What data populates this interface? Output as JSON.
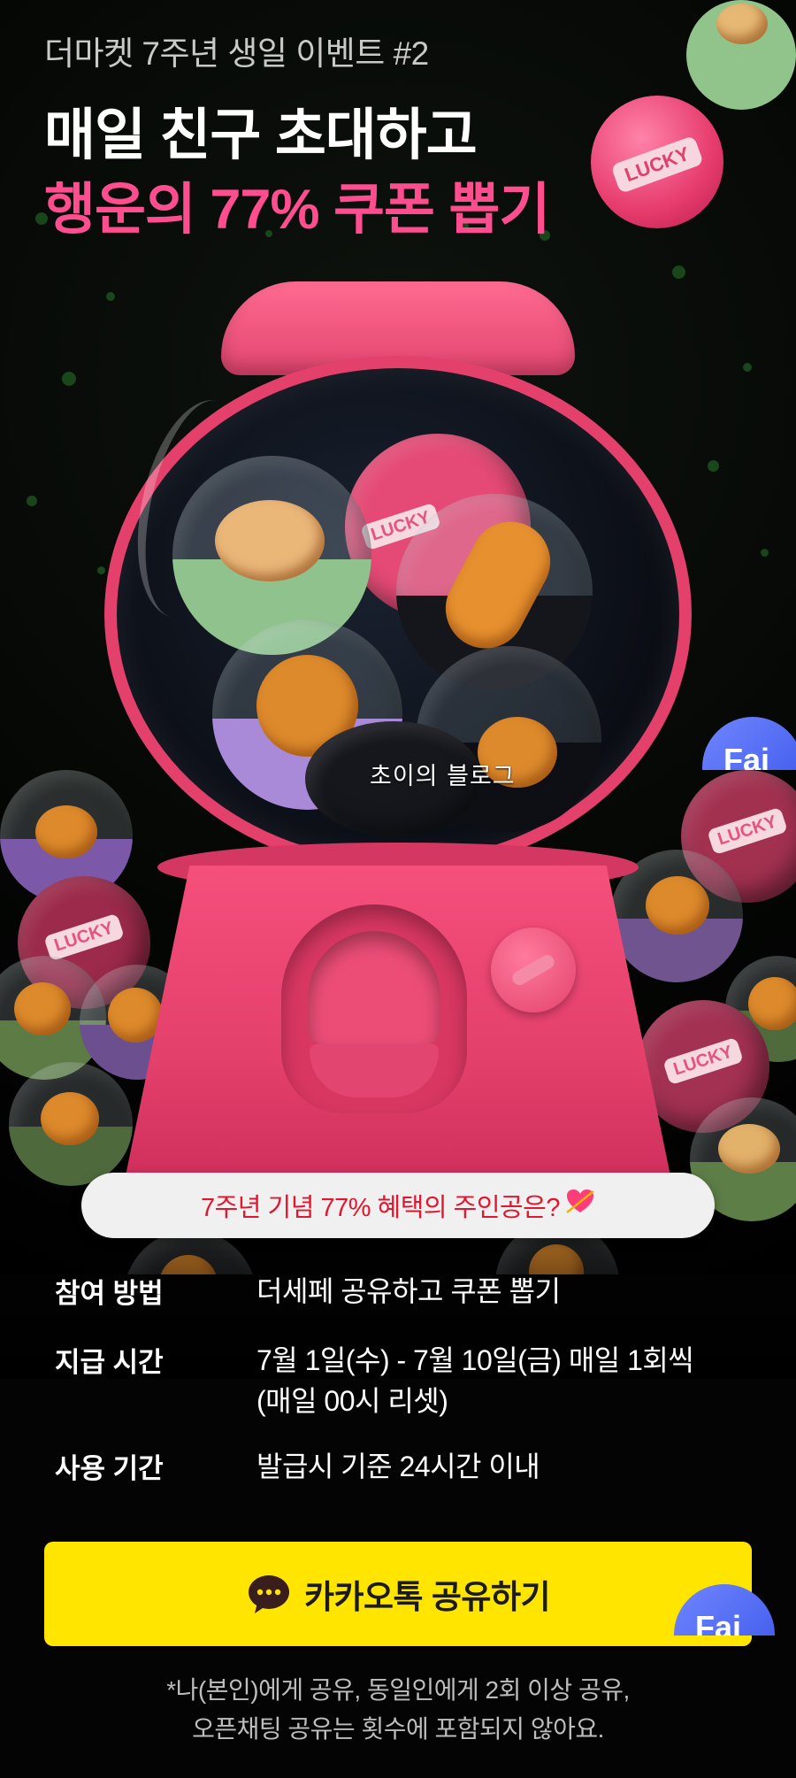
{
  "hero": {
    "event_label": "더마켓 7주년 생일 이벤트 #2",
    "headline_line1": "매일 친구 초대하고",
    "headline_line2": "행운의 77% 쿠폰 뽑기",
    "headline_accent_color": "#ff4e8f",
    "capsule_label": "LUCKY",
    "watermark": "초이의 블로그",
    "fab_label": "Fai"
  },
  "teaser": {
    "text": "7주년 기념 77% 혜택의 주인공은?",
    "icon": "heart-arrow-icon",
    "text_color": "#e0172f"
  },
  "info": {
    "rows": [
      {
        "label": "참여 방법",
        "value_lines": [
          "더세페 공유하고 쿠폰 뽑기"
        ]
      },
      {
        "label": "지급 시간",
        "value_lines": [
          "7월 1일(수) - 7월 10일(금) 매일 1회씩",
          "(매일 00시 리셋)"
        ]
      },
      {
        "label": "사용 기간",
        "value_lines": [
          "발급시 기준 24시간 이내"
        ]
      }
    ]
  },
  "cta": {
    "label": "카카오톡 공유하기",
    "icon": "kakao-chat-icon",
    "background": "#ffe500"
  },
  "footnote": {
    "line1": "*나(본인)에게 공유, 동일인에게 2회 이상 공유,",
    "line2": "오픈채팅 공유는 횟수에 포함되지 않아요."
  },
  "colors": {
    "machine_pink": "#e3416c",
    "background": "#000000"
  }
}
